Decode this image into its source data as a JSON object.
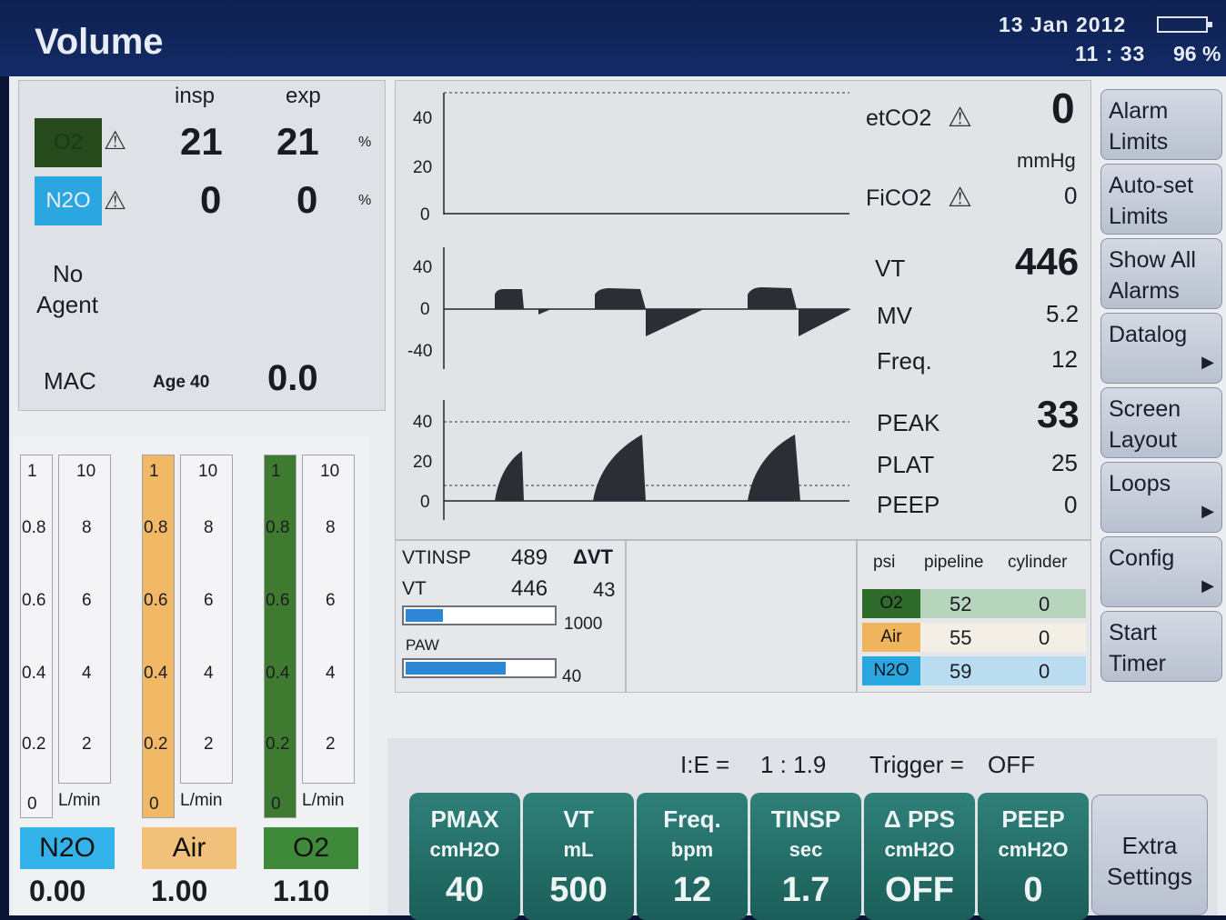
{
  "header": {
    "mode": "Volume",
    "date": "13  Jan  2012",
    "time": "11 : 33",
    "battery_pct": "96 %"
  },
  "gas": {
    "insp_label": "insp",
    "exp_label": "exp",
    "o2": {
      "label": "O2",
      "insp": "21",
      "exp": "21",
      "unit": "%",
      "color": "#264a1c"
    },
    "n2o": {
      "label": "N2O",
      "insp": "0",
      "exp": "0",
      "unit": "%",
      "color": "#2aa6e0"
    },
    "agent_line1": "No",
    "agent_line2": "Agent",
    "mac_label": "MAC",
    "age_label": "Age 40",
    "mac_value": "0.0"
  },
  "flowmeters": [
    {
      "name": "N2O",
      "value": "0.00",
      "color": "#33b3ea",
      "fill_color": "#f4f4f6"
    },
    {
      "name": "Air",
      "value": "1.00",
      "color": "#f1c07a",
      "fill_color": "#f1b866"
    },
    {
      "name": "O2",
      "value": "1.10",
      "color": "#3e8a3a",
      "fill_color": "#3f7a31"
    }
  ],
  "flow_scale": {
    "low": [
      "1",
      "0.8",
      "0.6",
      "0.4",
      "0.2",
      "0"
    ],
    "high": [
      "10",
      "8",
      "6",
      "4",
      "2"
    ],
    "unit": "L/min"
  },
  "waveforms": {
    "co2_axis": [
      "40",
      "20",
      "0"
    ],
    "flow_axis": [
      "40",
      "0",
      "-40"
    ],
    "paw_axis": [
      "40",
      "20",
      "0"
    ]
  },
  "readings": {
    "etco2_label": "etCO2",
    "etco2_value": "0",
    "etco2_unit": "mmHg",
    "fico2_label": "FiCO2",
    "fico2_value": "0",
    "vt_label": "VT",
    "vt_value": "446",
    "mv_label": "MV",
    "mv_value": "5.2",
    "freq_label": "Freq.",
    "freq_value": "12",
    "peak_label": "PEAK",
    "peak_value": "33",
    "plat_label": "PLAT",
    "plat_value": "25",
    "peep_label": "PEEP",
    "peep_value": "0"
  },
  "volume_box": {
    "vtinsp_label": "VTINSP",
    "vtinsp_value": "489",
    "dvt_label": "ΔVT",
    "dvt_value": "43",
    "vt_label": "VT",
    "vt_value": "446",
    "vt_bar_max": "1000",
    "vt_bar_fraction": 0.25,
    "paw_label": "PAW",
    "paw_bar_max": "40",
    "paw_bar_fraction": 0.68
  },
  "pressure_table": {
    "headers": [
      "psi",
      "pipeline",
      "cylinder"
    ],
    "rows": [
      {
        "gas": "O2",
        "pipeline": "52",
        "cylinder": "0",
        "color": "#2f6b2a",
        "bg": "#b7d5bd"
      },
      {
        "gas": "Air",
        "pipeline": "55",
        "cylinder": "0",
        "color": "#f0b55c",
        "bg": "#f3efe4"
      },
      {
        "gas": "N2O",
        "pipeline": "59",
        "cylinder": "0",
        "color": "#2aa6e0",
        "bg": "#b9dcf1"
      }
    ]
  },
  "side_menu": [
    {
      "line1": "Alarm",
      "line2": "Limits",
      "arrow": false
    },
    {
      "line1": "Auto-set",
      "line2": "Limits",
      "arrow": false
    },
    {
      "line1": "Show All",
      "line2": "Alarms",
      "arrow": false
    },
    {
      "line1": "Datalog",
      "line2": "",
      "arrow": true
    },
    {
      "line1": "Screen",
      "line2": "Layout",
      "arrow": false
    },
    {
      "line1": "Loops",
      "line2": "",
      "arrow": true
    },
    {
      "line1": "Config",
      "line2": "",
      "arrow": true
    },
    {
      "line1": "Start",
      "line2": "Timer",
      "arrow": false
    }
  ],
  "settings": {
    "ie_label": "I:E =",
    "ie_value": "1 : 1.9",
    "trigger_label": "Trigger =",
    "trigger_value": "OFF",
    "buttons": [
      {
        "l1": "PMAX",
        "l2": "cmH2O",
        "v": "40"
      },
      {
        "l1": "VT",
        "l2": "mL",
        "v": "500"
      },
      {
        "l1": "Freq.",
        "l2": "bpm",
        "v": "12"
      },
      {
        "l1": "TINSP",
        "l2": "sec",
        "v": "1.7"
      },
      {
        "l1": "Δ PPS",
        "l2": "cmH2O",
        "v": "OFF"
      },
      {
        "l1": "PEEP",
        "l2": "cmH2O",
        "v": "0"
      }
    ],
    "extra_line1": "Extra",
    "extra_line2": "Settings"
  }
}
